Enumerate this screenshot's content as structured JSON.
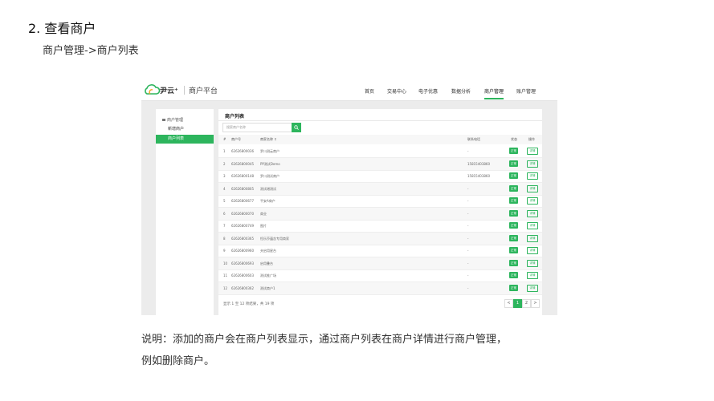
{
  "doc": {
    "title": "2. 查看商户",
    "subtitle": "商户管理->商户列表",
    "description_line1": "说明：添加的商户会在商户列表显示，通过商户列表在商户详情进行商户管理，",
    "description_line2": "例如删除商户。"
  },
  "app": {
    "brand": "尹云⁺",
    "platform": "商户平台",
    "accent_color": "#2db55d",
    "nav": [
      "首页",
      "交易中心",
      "电子优惠",
      "数据分析",
      "商户管理",
      "账户管理"
    ],
    "active_nav": "商户管理"
  },
  "sidebar": {
    "heading": "商户管理",
    "items": [
      "新增商户",
      "商户列表"
    ],
    "active": "商户列表"
  },
  "main": {
    "title": "商户列表",
    "search_placeholder": "搜索商户名称",
    "columns": [
      "#",
      "商户号",
      "商家名称 ↕",
      "联系电话",
      "状态",
      "操作"
    ],
    "rows": [
      {
        "no": "1",
        "id": "62626800036",
        "name": "罗川测云商户",
        "phone": "-",
        "status": "正常",
        "action": "详情"
      },
      {
        "no": "2",
        "id": "62626800045",
        "name": "PP测试Demo",
        "phone": "15815403860",
        "status": "正常",
        "action": "详情"
      },
      {
        "no": "3",
        "id": "62626800148",
        "name": "罗川测试商户",
        "phone": "15815403860",
        "status": "正常",
        "action": "详情"
      },
      {
        "no": "4",
        "id": "62626800805",
        "name": "测试增测试",
        "phone": "-",
        "status": "正常",
        "action": "详情"
      },
      {
        "no": "5",
        "id": "62626800677",
        "name": "平安A商户",
        "phone": "-",
        "status": "正常",
        "action": "详情"
      },
      {
        "no": "6",
        "id": "62626800070",
        "name": "商业",
        "phone": "-",
        "status": "正常",
        "action": "详情"
      },
      {
        "no": "7",
        "id": "62626800749",
        "name": "图片",
        "phone": "-",
        "status": "正常",
        "action": "详情"
      },
      {
        "no": "8",
        "id": "62626800365",
        "name": "恒乐莎蕴含专用商家",
        "phone": "-",
        "status": "正常",
        "action": "详情"
      },
      {
        "no": "9",
        "id": "62626800960",
        "name": "夫启用星台",
        "phone": "-",
        "status": "正常",
        "action": "详情"
      },
      {
        "no": "10",
        "id": "62626800693",
        "name": "启用叠台",
        "phone": "-",
        "status": "正常",
        "action": "详情"
      },
      {
        "no": "11",
        "id": "62626800603",
        "name": "测试推广场",
        "phone": "-",
        "status": "正常",
        "action": "详情"
      },
      {
        "no": "12",
        "id": "62626800362",
        "name": "测试商户1",
        "phone": "-",
        "status": "正常",
        "action": "详情"
      }
    ],
    "footer": "显示 1 至 12 项结果，共 19 项",
    "pagination": {
      "prev": "<",
      "pages": [
        "1",
        "2"
      ],
      "current": "1",
      "next": ">"
    }
  }
}
